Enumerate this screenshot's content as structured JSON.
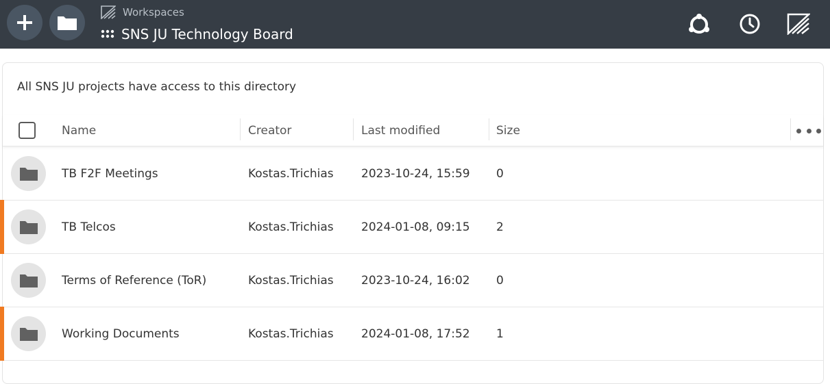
{
  "header": {
    "workspaces_label": "Workspaces",
    "workspace_name": "SNS JU Technology Board",
    "icons": [
      "plus-icon",
      "folder-icon",
      "workspaces-logo-icon",
      "grid-dots-icon",
      "collaboration-icon",
      "clock-icon",
      "pydio-logo-icon"
    ]
  },
  "main": {
    "description": "All SNS JU projects have access to this directory",
    "columns": {
      "name": "Name",
      "creator": "Creator",
      "last_modified": "Last modified",
      "size": "Size"
    },
    "rows": [
      {
        "name": "TB F2F Meetings",
        "creator": "Kostas.Trichias",
        "modified": "2023-10-24, 15:59",
        "size": "0",
        "highlighted": false
      },
      {
        "name": "TB Telcos",
        "creator": "Kostas.Trichias",
        "modified": "2024-01-08, 09:15",
        "size": "2",
        "highlighted": true
      },
      {
        "name": "Terms of Reference (ToR)",
        "creator": "Kostas.Trichias",
        "modified": "2023-10-24, 16:02",
        "size": "0",
        "highlighted": false
      },
      {
        "name": "Working Documents",
        "creator": "Kostas.Trichias",
        "modified": "2024-01-08, 17:52",
        "size": "1",
        "highlighted": true
      }
    ]
  },
  "colors": {
    "topbar": "#363d45",
    "accent": "#f07a21",
    "folder_bg": "#e4e4e4"
  }
}
